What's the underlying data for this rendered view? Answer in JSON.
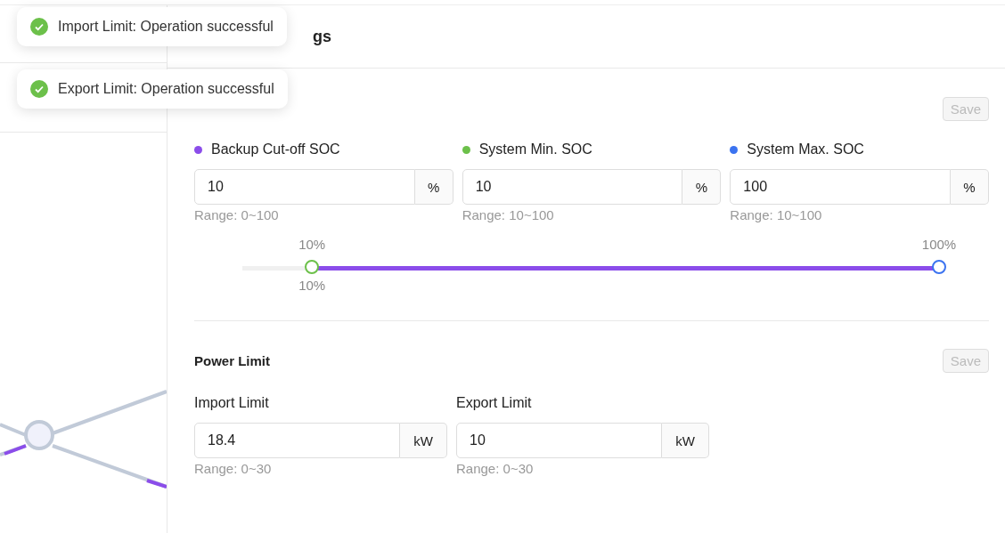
{
  "toasts": [
    {
      "text": "Import Limit: Operation successful"
    },
    {
      "text": "Export Limit: Operation successful"
    }
  ],
  "header": {
    "title": "gs"
  },
  "soc": {
    "save": "Save",
    "fields": [
      {
        "label": "Backup Cut-off SOC",
        "color": "#8b4dea",
        "value": "10",
        "unit": "%",
        "range": "Range: 0~100"
      },
      {
        "label": "System Min. SOC",
        "color": "#6cc04a",
        "value": "10",
        "unit": "%",
        "range": "Range: 10~100"
      },
      {
        "label": "System Max. SOC",
        "color": "#3b73f0",
        "value": "100",
        "unit": "%",
        "range": "Range: 10~100"
      }
    ],
    "slider": {
      "thumbs": [
        {
          "level": 0.1,
          "label": "10%"
        },
        {
          "level": 1.0,
          "label": "100%"
        }
      ],
      "cutoff_label": "10%"
    }
  },
  "power": {
    "title": "Power Limit",
    "save": "Save",
    "fields": [
      {
        "label": "Import Limit",
        "value": "18.4",
        "unit": "kW",
        "range": "Range: 0~30"
      },
      {
        "label": "Export Limit",
        "value": "10",
        "unit": "kW",
        "range": "Range: 0~30"
      }
    ]
  }
}
